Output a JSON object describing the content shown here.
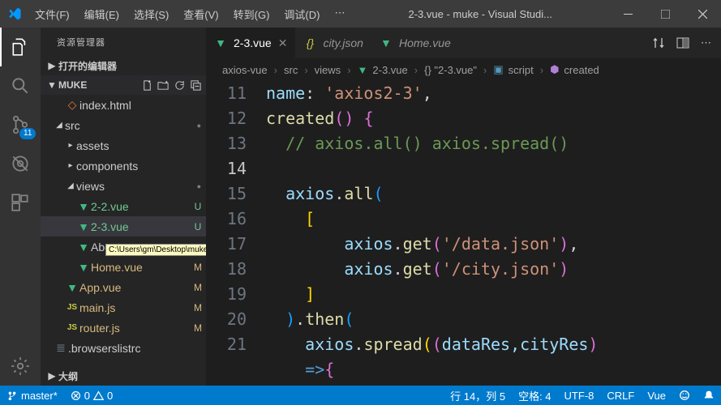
{
  "window": {
    "title": "2-3.vue - muke - Visual Studi..."
  },
  "menu": {
    "file": "文件(F)",
    "edit": "编辑(E)",
    "select": "选择(S)",
    "view": "查看(V)",
    "goto": "转到(G)",
    "debug": "调试(D)",
    "more": "⋯"
  },
  "activity": {
    "scm_badge": "11"
  },
  "sidebar": {
    "title": "资源管理器",
    "open_editors": "打开的编辑器",
    "project": "MUKE",
    "outline": "大纲",
    "tree": {
      "index_html": "index.html",
      "src": "src",
      "assets": "assets",
      "components": "components",
      "views": "views",
      "f22": "2-2.vue",
      "f23": "2-3.vue",
      "about": "About.vue",
      "home": "Home.vue",
      "app": "App.vue",
      "mainjs": "main.js",
      "routerjs": "router.js",
      "browserslist": ".browserslistrc"
    },
    "git": {
      "U": "U",
      "M": "M"
    }
  },
  "tabs": {
    "t1": "2-3.vue",
    "t2": "city.json",
    "t3": "Home.vue"
  },
  "breadcrumb": {
    "p1": "axios-vue",
    "p2": "src",
    "p3": "views",
    "p4": "2-3.vue",
    "p5": "{} \"2-3.vue\"",
    "p6": "script",
    "p7": "created"
  },
  "code": {
    "lines": {
      "l11": "11",
      "l12": "12",
      "l13": "13",
      "l14": "14",
      "l15": "15",
      "l16": "16",
      "l17": "17",
      "l18": "18",
      "l19": "19",
      "l20": "20",
      "l21": "21"
    },
    "name_key": "name",
    "name_val": "'axios2-3'",
    "created": "created",
    "comment": "// axios.all() axios.spread()",
    "axios": "axios",
    "all": "all",
    "get": "get",
    "then": "then",
    "spread": "spread",
    "url1": "'/data.json'",
    "url2": "'/city.json'",
    "params": "dataRes,cityRes"
  },
  "tooltip": "C:\\Users\\gm\\Desktop\\muke\\axios-vue\\src\\views\\About.vue",
  "status": {
    "branch": "master*",
    "errors": "0",
    "warnings": "0",
    "cursor": "行 14，列 5",
    "spaces": "空格: 4",
    "encoding": "UTF-8",
    "eol": "CRLF",
    "lang": "Vue"
  }
}
